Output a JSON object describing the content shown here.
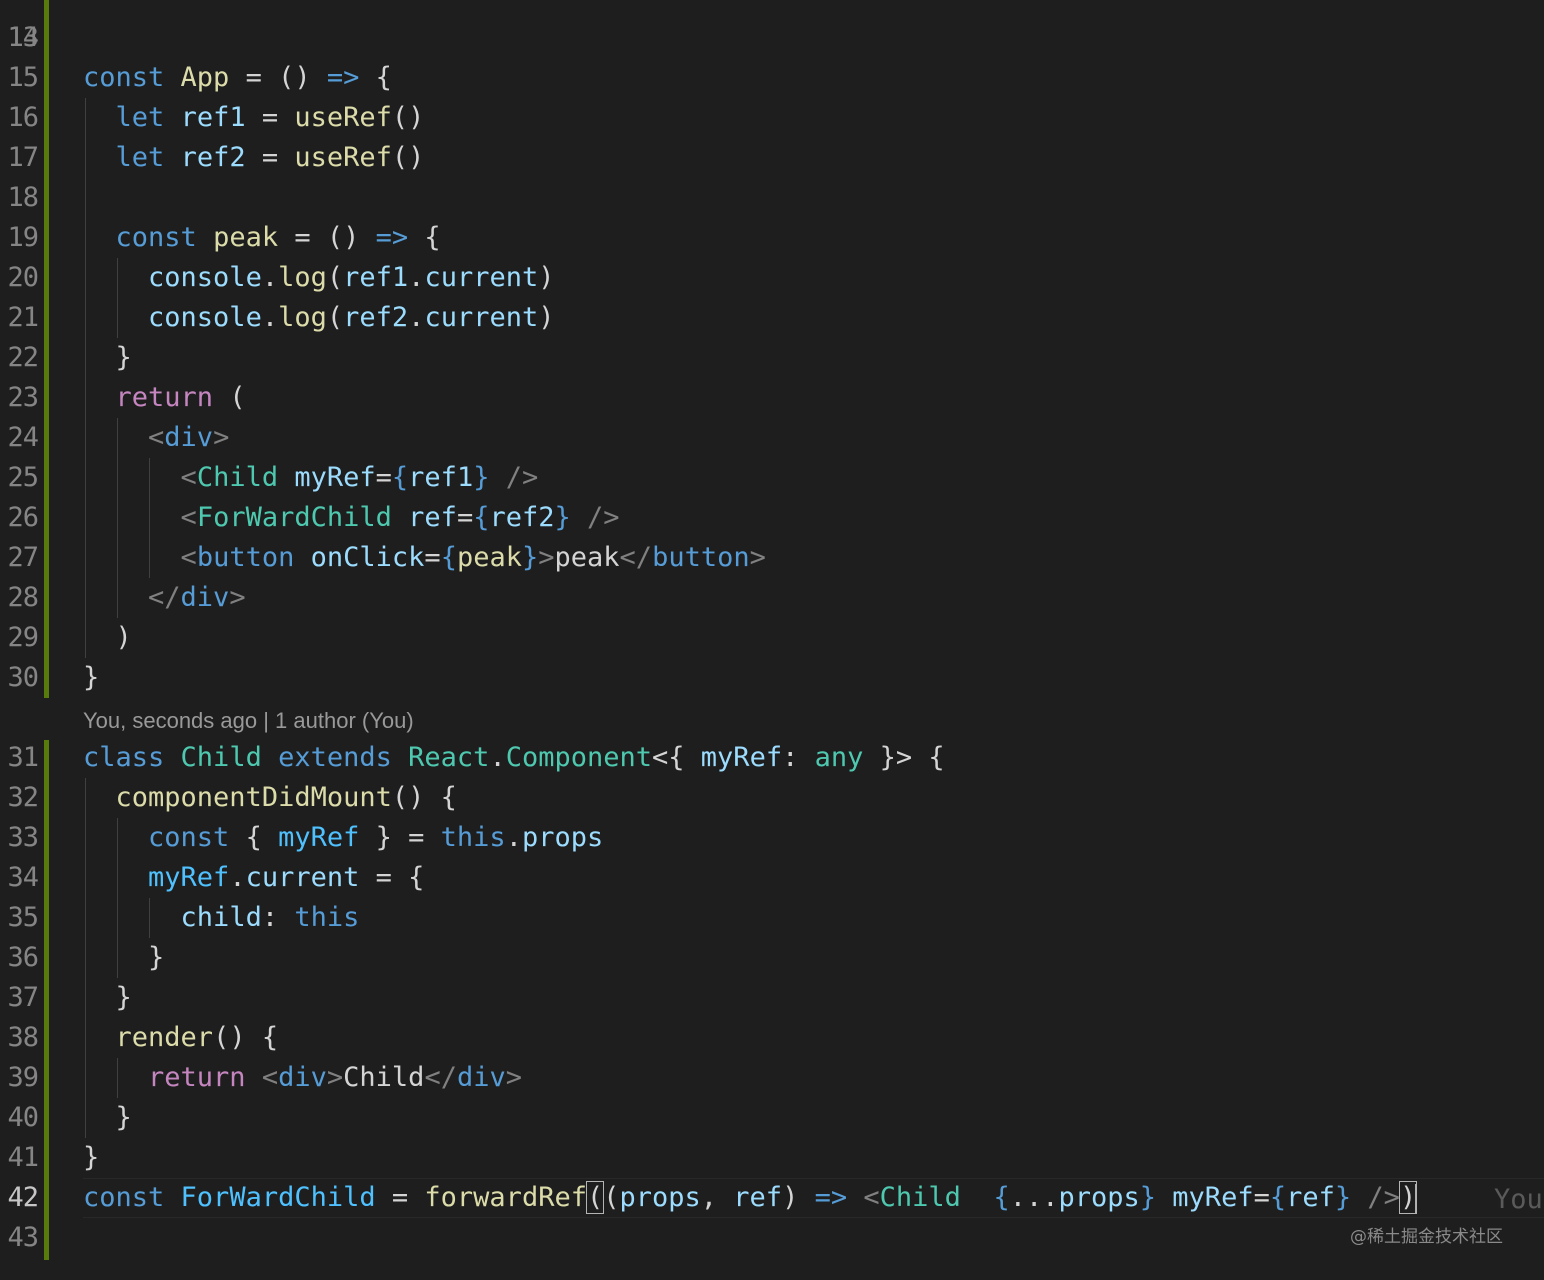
{
  "editor": {
    "colors": {
      "background": "#1e1e1e",
      "line_number": "#858585",
      "gutter_modified": "#587c0c",
      "keyword": "#569cd6",
      "control": "#c586c0",
      "function": "#dcdcaa",
      "variable": "#9cdcfe",
      "constant": "#4fc1ff",
      "type": "#4ec9b0"
    },
    "cut_line_number": "13",
    "active_line": "42",
    "codelens": "You, seconds ago | 1 author (You)",
    "inline_blame": "You",
    "watermark": "@稀土掘金技术社区",
    "lines": [
      {
        "n": "14",
        "tokens": []
      },
      {
        "n": "15",
        "tokens": [
          [
            "kw",
            "const"
          ],
          [
            "pun",
            " "
          ],
          [
            "fn",
            "App"
          ],
          [
            "pun",
            " = () "
          ],
          [
            "kw",
            "=>"
          ],
          [
            "pun",
            " {"
          ]
        ]
      },
      {
        "n": "16",
        "tokens": [
          [
            "pun",
            "  "
          ],
          [
            "kw",
            "let"
          ],
          [
            "pun",
            " "
          ],
          [
            "var",
            "ref1"
          ],
          [
            "pun",
            " = "
          ],
          [
            "fn",
            "useRef"
          ],
          [
            "pun",
            "()"
          ]
        ]
      },
      {
        "n": "17",
        "tokens": [
          [
            "pun",
            "  "
          ],
          [
            "kw",
            "let"
          ],
          [
            "pun",
            " "
          ],
          [
            "var",
            "ref2"
          ],
          [
            "pun",
            " = "
          ],
          [
            "fn",
            "useRef"
          ],
          [
            "pun",
            "()"
          ]
        ]
      },
      {
        "n": "18",
        "tokens": []
      },
      {
        "n": "19",
        "tokens": [
          [
            "pun",
            "  "
          ],
          [
            "kw",
            "const"
          ],
          [
            "pun",
            " "
          ],
          [
            "fn",
            "peak"
          ],
          [
            "pun",
            " = () "
          ],
          [
            "kw",
            "=>"
          ],
          [
            "pun",
            " {"
          ]
        ]
      },
      {
        "n": "20",
        "tokens": [
          [
            "pun",
            "    "
          ],
          [
            "var",
            "console"
          ],
          [
            "pun",
            "."
          ],
          [
            "fn",
            "log"
          ],
          [
            "pun",
            "("
          ],
          [
            "var",
            "ref1"
          ],
          [
            "pun",
            "."
          ],
          [
            "var",
            "current"
          ],
          [
            "pun",
            ")"
          ]
        ]
      },
      {
        "n": "21",
        "tokens": [
          [
            "pun",
            "    "
          ],
          [
            "var",
            "console"
          ],
          [
            "pun",
            "."
          ],
          [
            "fn",
            "log"
          ],
          [
            "pun",
            "("
          ],
          [
            "var",
            "ref2"
          ],
          [
            "pun",
            "."
          ],
          [
            "var",
            "current"
          ],
          [
            "pun",
            ")"
          ]
        ]
      },
      {
        "n": "22",
        "tokens": [
          [
            "pun",
            "  }"
          ]
        ]
      },
      {
        "n": "23",
        "tokens": [
          [
            "pun",
            "  "
          ],
          [
            "ctl",
            "return"
          ],
          [
            "pun",
            " ("
          ]
        ]
      },
      {
        "n": "24",
        "tokens": [
          [
            "pun",
            "    "
          ],
          [
            "tagp",
            "<"
          ],
          [
            "tag",
            "div"
          ],
          [
            "tagp",
            ">"
          ]
        ]
      },
      {
        "n": "25",
        "tokens": [
          [
            "pun",
            "      "
          ],
          [
            "tagp",
            "<"
          ],
          [
            "typ",
            "Child"
          ],
          [
            "pun",
            " "
          ],
          [
            "var",
            "myRef"
          ],
          [
            "pun",
            "="
          ],
          [
            "kw",
            "{"
          ],
          [
            "var",
            "ref1"
          ],
          [
            "kw",
            "}"
          ],
          [
            "pun",
            " "
          ],
          [
            "tagp",
            "/>"
          ]
        ]
      },
      {
        "n": "26",
        "tokens": [
          [
            "pun",
            "      "
          ],
          [
            "tagp",
            "<"
          ],
          [
            "typ",
            "ForWardChild"
          ],
          [
            "pun",
            " "
          ],
          [
            "var",
            "ref"
          ],
          [
            "pun",
            "="
          ],
          [
            "kw",
            "{"
          ],
          [
            "var",
            "ref2"
          ],
          [
            "kw",
            "}"
          ],
          [
            "pun",
            " "
          ],
          [
            "tagp",
            "/>"
          ]
        ]
      },
      {
        "n": "27",
        "tokens": [
          [
            "pun",
            "      "
          ],
          [
            "tagp",
            "<"
          ],
          [
            "tag",
            "button"
          ],
          [
            "pun",
            " "
          ],
          [
            "var",
            "onClick"
          ],
          [
            "pun",
            "="
          ],
          [
            "kw",
            "{"
          ],
          [
            "fn",
            "peak"
          ],
          [
            "kw",
            "}"
          ],
          [
            "tagp",
            ">"
          ],
          [
            "txt",
            "peak"
          ],
          [
            "tagp",
            "</"
          ],
          [
            "tag",
            "button"
          ],
          [
            "tagp",
            ">"
          ]
        ]
      },
      {
        "n": "28",
        "tokens": [
          [
            "pun",
            "    "
          ],
          [
            "tagp",
            "</"
          ],
          [
            "tag",
            "div"
          ],
          [
            "tagp",
            ">"
          ]
        ]
      },
      {
        "n": "29",
        "tokens": [
          [
            "pun",
            "  )"
          ]
        ]
      },
      {
        "n": "30",
        "tokens": [
          [
            "pun",
            "}"
          ]
        ]
      },
      {
        "n": "31",
        "tokens": [
          [
            "kw",
            "class"
          ],
          [
            "pun",
            " "
          ],
          [
            "typ",
            "Child"
          ],
          [
            "pun",
            " "
          ],
          [
            "kw",
            "extends"
          ],
          [
            "pun",
            " "
          ],
          [
            "typ",
            "React"
          ],
          [
            "pun",
            "."
          ],
          [
            "typ",
            "Component"
          ],
          [
            "pun",
            "<{ "
          ],
          [
            "var",
            "myRef"
          ],
          [
            "pun",
            ": "
          ],
          [
            "typ",
            "any"
          ],
          [
            "pun",
            " }> {"
          ]
        ]
      },
      {
        "n": "32",
        "tokens": [
          [
            "pun",
            "  "
          ],
          [
            "fn",
            "componentDidMount"
          ],
          [
            "pun",
            "() {"
          ]
        ]
      },
      {
        "n": "33",
        "tokens": [
          [
            "pun",
            "    "
          ],
          [
            "kw",
            "const"
          ],
          [
            "pun",
            " { "
          ],
          [
            "cst",
            "myRef"
          ],
          [
            "pun",
            " } = "
          ],
          [
            "kw",
            "this"
          ],
          [
            "pun",
            "."
          ],
          [
            "var",
            "props"
          ]
        ]
      },
      {
        "n": "34",
        "tokens": [
          [
            "pun",
            "    "
          ],
          [
            "cst",
            "myRef"
          ],
          [
            "pun",
            "."
          ],
          [
            "var",
            "current"
          ],
          [
            "pun",
            " = {"
          ]
        ]
      },
      {
        "n": "35",
        "tokens": [
          [
            "pun",
            "      "
          ],
          [
            "var",
            "child"
          ],
          [
            "pun",
            ": "
          ],
          [
            "kw",
            "this"
          ]
        ]
      },
      {
        "n": "36",
        "tokens": [
          [
            "pun",
            "    }"
          ]
        ]
      },
      {
        "n": "37",
        "tokens": [
          [
            "pun",
            "  }"
          ]
        ]
      },
      {
        "n": "38",
        "tokens": [
          [
            "pun",
            "  "
          ],
          [
            "fn",
            "render"
          ],
          [
            "pun",
            "() {"
          ]
        ]
      },
      {
        "n": "39",
        "tokens": [
          [
            "pun",
            "    "
          ],
          [
            "ctl",
            "return"
          ],
          [
            "pun",
            " "
          ],
          [
            "tagp",
            "<"
          ],
          [
            "tag",
            "div"
          ],
          [
            "tagp",
            ">"
          ],
          [
            "txt",
            "Child"
          ],
          [
            "tagp",
            "</"
          ],
          [
            "tag",
            "div"
          ],
          [
            "tagp",
            ">"
          ]
        ]
      },
      {
        "n": "40",
        "tokens": [
          [
            "pun",
            "  }"
          ]
        ]
      },
      {
        "n": "41",
        "tokens": [
          [
            "pun",
            "}"
          ]
        ]
      },
      {
        "n": "42",
        "tokens": [
          [
            "kw",
            "const"
          ],
          [
            "pun",
            " "
          ],
          [
            "cst",
            "ForWardChild"
          ],
          [
            "pun",
            " = "
          ],
          [
            "fn",
            "forwardRef"
          ],
          [
            "bracket",
            "("
          ],
          [
            "pun",
            "("
          ],
          [
            "var",
            "props"
          ],
          [
            "pun",
            ", "
          ],
          [
            "var",
            "ref"
          ],
          [
            "pun",
            ") "
          ],
          [
            "kw",
            "=>"
          ],
          [
            "pun",
            " "
          ],
          [
            "tagp",
            "<"
          ],
          [
            "typ",
            "Child"
          ],
          [
            "pun",
            "  "
          ],
          [
            "kw",
            "{"
          ],
          [
            "pun",
            "..."
          ],
          [
            "var",
            "props"
          ],
          [
            "kw",
            "}"
          ],
          [
            "pun",
            " "
          ],
          [
            "var",
            "myRef"
          ],
          [
            "pun",
            "="
          ],
          [
            "kw",
            "{"
          ],
          [
            "var",
            "ref"
          ],
          [
            "kw",
            "}"
          ],
          [
            "pun",
            " "
          ],
          [
            "tagp",
            "/>"
          ],
          [
            "bracket",
            ")"
          ],
          [
            "caret",
            ""
          ]
        ]
      },
      {
        "n": "43",
        "tokens": []
      }
    ]
  }
}
